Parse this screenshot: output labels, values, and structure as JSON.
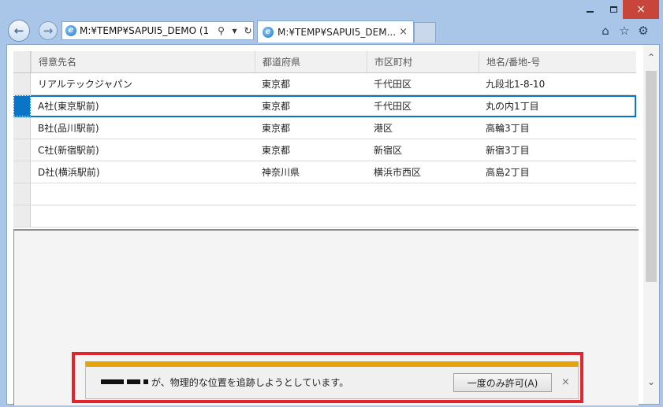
{
  "window": {
    "controls": {
      "minimize_icon": "minimize-icon",
      "maximize_icon": "maximize-icon",
      "close_glyph": "×"
    }
  },
  "toolbar": {
    "back_glyph": "←",
    "forward_glyph": "→",
    "address": "M:¥TEMP¥SAPUI5_DEMO (1",
    "search_glyph": "⚲",
    "dropdown_glyph": "▾",
    "refresh_glyph": "↻",
    "tab_title": "M:¥TEMP¥SAPUI5_DEM...",
    "tab_close_glyph": "×",
    "home_glyph": "⌂",
    "favorites_glyph": "☆",
    "tools_glyph": "⚙"
  },
  "table": {
    "columns": [
      "得意先名",
      "都道府県",
      "市区町村",
      "地名/番地-号"
    ],
    "rows": [
      [
        "リアルテックジャパン",
        "東京都",
        "千代田区",
        "九段北1-8-10"
      ],
      [
        "A社(東京駅前)",
        "東京都",
        "千代田区",
        "丸の内1丁目"
      ],
      [
        "B社(品川駅前)",
        "東京都",
        "港区",
        "高輪3丁目"
      ],
      [
        "C社(新宿駅前)",
        "東京都",
        "新宿区",
        "新宿3丁目"
      ],
      [
        "D社(横浜駅前)",
        "神奈川県",
        "横浜市西区",
        "高島2丁目"
      ],
      [
        "",
        "",
        "",
        ""
      ],
      [
        "",
        "",
        "",
        ""
      ]
    ],
    "focused_row": 1
  },
  "scrollbar": {
    "up_glyph": "⌃",
    "down_glyph": "⌄"
  },
  "notification": {
    "message": "が、物理的な位置を追跡しようとしています。",
    "allow_button": "一度のみ許可(A)",
    "close_glyph": "×",
    "accent_color": "#e5a40a",
    "highlight_color": "#e2252b"
  }
}
